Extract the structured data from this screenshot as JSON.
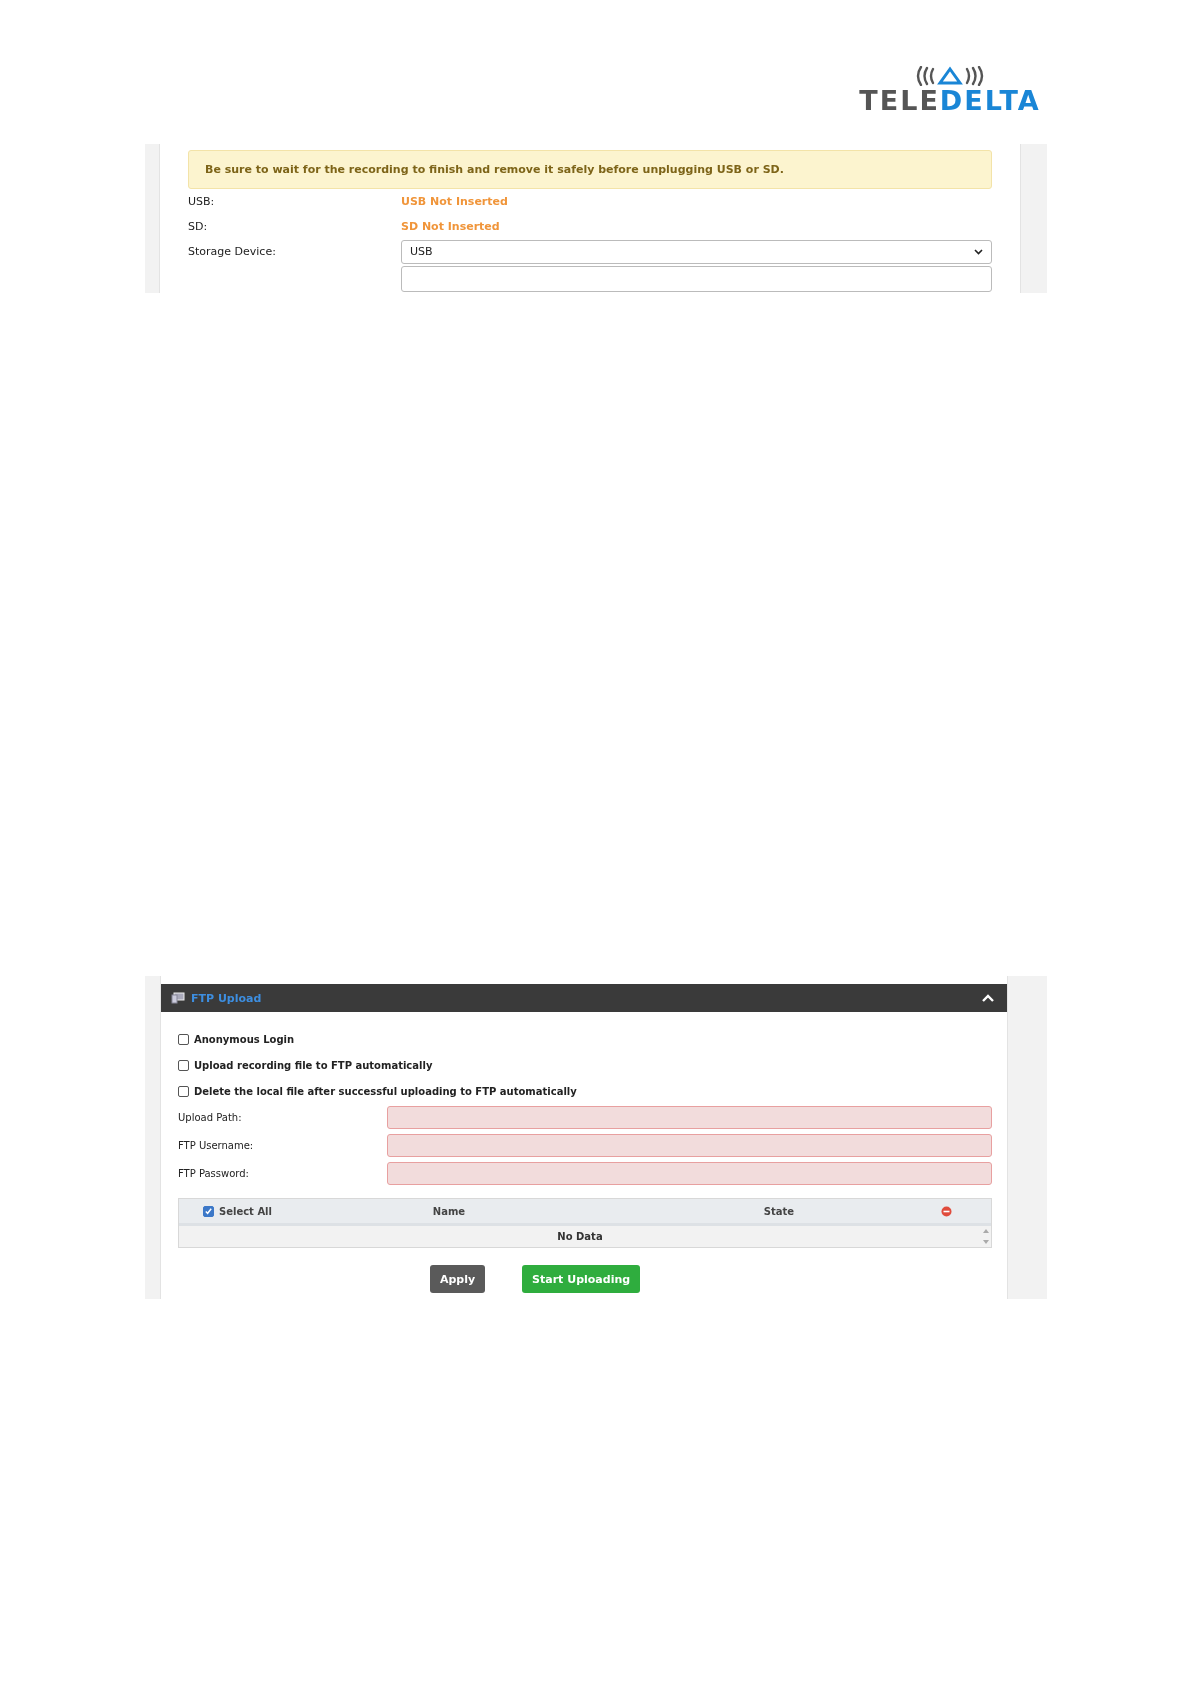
{
  "logo": {
    "text_left": "TELE",
    "text_right": "DELTA"
  },
  "storage_panel": {
    "alert": "Be sure to wait for the recording to finish and remove it safely before unplugging USB or SD.",
    "status_rows": [
      {
        "label": "USB:",
        "value": "USB Not Inserted"
      },
      {
        "label": "SD:",
        "value": "SD Not Inserted"
      }
    ],
    "storage_device": {
      "label": "Storage Device:",
      "value": "USB"
    }
  },
  "ftp_panel": {
    "title": "FTP Upload",
    "expanded": true,
    "options": [
      {
        "label": "Anonymous Login",
        "checked": false
      },
      {
        "label": "Upload recording file to FTP automatically",
        "checked": false
      },
      {
        "label": "Delete the local file after successful uploading to FTP automatically",
        "checked": false
      }
    ],
    "fields": [
      {
        "label": "Upload Path:"
      },
      {
        "label": "FTP Username:"
      },
      {
        "label": "FTP Password:"
      }
    ],
    "table": {
      "select_all": {
        "label": "Select All",
        "checked": true
      },
      "columns": [
        "Name",
        "State"
      ],
      "empty_text": "No Data"
    },
    "buttons": [
      {
        "label": "Apply",
        "kind": "secondary"
      },
      {
        "label": "Start Uploading",
        "kind": "primary"
      }
    ]
  }
}
